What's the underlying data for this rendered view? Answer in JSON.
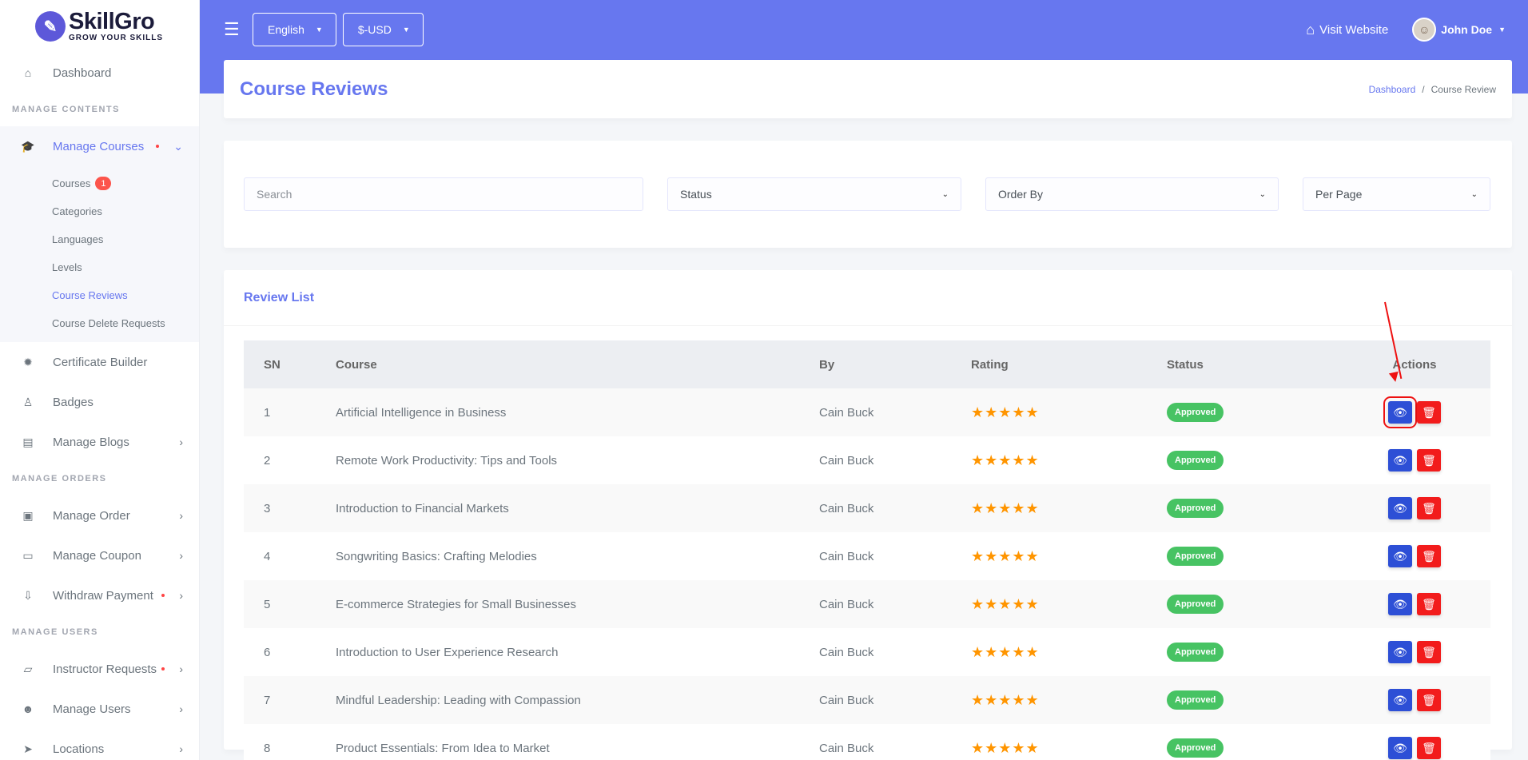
{
  "brand": {
    "name": "SkillGro",
    "tagline": "GROW YOUR SKILLS"
  },
  "sidebar": {
    "dashboard": "Dashboard",
    "sections": {
      "manage_contents": "MANAGE CONTENTS",
      "manage_orders": "MANAGE ORDERS",
      "manage_users": "MANAGE USERS"
    },
    "manage_courses": "Manage Courses",
    "sub_items": [
      {
        "label": "Courses",
        "badge": "1"
      },
      {
        "label": "Categories"
      },
      {
        "label": "Languages"
      },
      {
        "label": "Levels"
      },
      {
        "label": "Course Reviews"
      },
      {
        "label": "Course Delete Requests"
      }
    ],
    "certificate_builder": "Certificate Builder",
    "badges": "Badges",
    "manage_blogs": "Manage Blogs",
    "manage_order": "Manage Order",
    "manage_coupon": "Manage Coupon",
    "withdraw_payment": "Withdraw Payment",
    "instructor_requests": "Instructor Requests",
    "manage_users": "Manage Users",
    "locations": "Locations"
  },
  "topbar": {
    "language": "English",
    "currency": "$-USD",
    "visit_website": "Visit Website",
    "user_name": "John Doe"
  },
  "header": {
    "title": "Course Reviews",
    "breadcrumb": {
      "link": "Dashboard",
      "separator": "/",
      "current": "Course Review"
    }
  },
  "filters": {
    "search_placeholder": "Search",
    "status": "Status",
    "order_by": "Order By",
    "per_page": "Per Page"
  },
  "list": {
    "title": "Review List",
    "columns": {
      "sn": "SN",
      "course": "Course",
      "by": "By",
      "rating": "Rating",
      "status": "Status",
      "actions": "Actions"
    },
    "rows": [
      {
        "sn": "1",
        "course": "Artificial Intelligence in Business",
        "by": "Cain Buck",
        "rating": "★★★★★",
        "status": "Approved"
      },
      {
        "sn": "2",
        "course": "Remote Work Productivity: Tips and Tools",
        "by": "Cain Buck",
        "rating": "★★★★★",
        "status": "Approved"
      },
      {
        "sn": "3",
        "course": "Introduction to Financial Markets",
        "by": "Cain Buck",
        "rating": "★★★★★",
        "status": "Approved"
      },
      {
        "sn": "4",
        "course": "Songwriting Basics: Crafting Melodies",
        "by": "Cain Buck",
        "rating": "★★★★★",
        "status": "Approved"
      },
      {
        "sn": "5",
        "course": "E-commerce Strategies for Small Businesses",
        "by": "Cain Buck",
        "rating": "★★★★★",
        "status": "Approved"
      },
      {
        "sn": "6",
        "course": "Introduction to User Experience Research",
        "by": "Cain Buck",
        "rating": "★★★★★",
        "status": "Approved"
      },
      {
        "sn": "7",
        "course": "Mindful Leadership: Leading with Compassion",
        "by": "Cain Buck",
        "rating": "★★★★★",
        "status": "Approved"
      },
      {
        "sn": "8",
        "course": "Product Essentials: From Idea to Market",
        "by": "Cain Buck",
        "rating": "★★★★★",
        "status": "Approved"
      }
    ]
  },
  "colors": {
    "primary": "#6777ef",
    "success": "#47c363",
    "danger": "#f21c1c",
    "view_button": "#2d4fd6",
    "star": "#ff9500"
  }
}
